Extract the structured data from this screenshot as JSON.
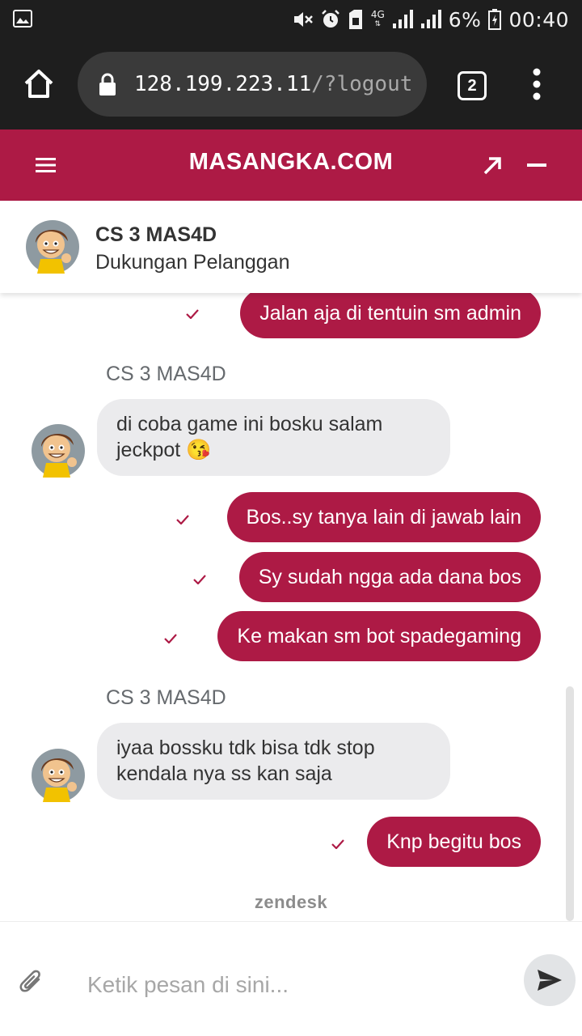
{
  "status_bar": {
    "network": "4G",
    "battery": "6%",
    "time": "00:40"
  },
  "browser": {
    "url_host": "128.199.223.11",
    "url_path": "/?logout",
    "tab_count": "2"
  },
  "app": {
    "title": "MASANGKA.COM",
    "brand_color": "#ad1a45"
  },
  "agent": {
    "name": "CS 3 MAS4D",
    "role": "Dukungan Pelanggan"
  },
  "messages": [
    {
      "from": "user",
      "text": "Jalan aja di tentuin sm admin"
    },
    {
      "from": "agent",
      "sender": "CS 3 MAS4D",
      "line1": "di coba game ini bosku salam",
      "line2": "jeckpot 😘"
    },
    {
      "from": "user",
      "text": "Bos..sy tanya lain di jawab lain"
    },
    {
      "from": "user",
      "text": "Sy sudah ngga ada dana bos"
    },
    {
      "from": "user",
      "text": "Ke makan sm bot spadegaming"
    },
    {
      "from": "agent",
      "sender": "CS 3 MAS4D",
      "line1": "iyaa bossku tdk bisa tdk stop",
      "line2": "kendala nya ss kan saja"
    },
    {
      "from": "user",
      "text": "Knp begitu bos"
    }
  ],
  "footer_brand": "zendesk",
  "composer": {
    "placeholder": "Ketik pesan di sini..."
  }
}
